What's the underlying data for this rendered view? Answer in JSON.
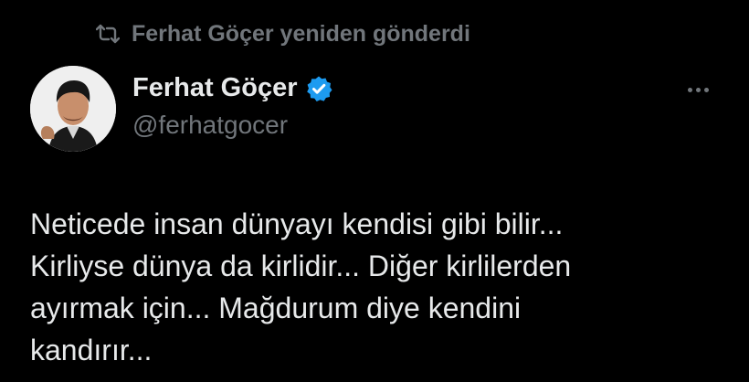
{
  "repost": {
    "icon": "repost-icon",
    "label": "Ferhat Göçer yeniden gönderdi"
  },
  "author": {
    "name": "Ferhat Göçer",
    "handle": "@ferhatgocer",
    "verified": true,
    "verified_color": "#1d9bf0",
    "avatar_icon": "avatar"
  },
  "menu": {
    "icon": "more-icon"
  },
  "tweet": {
    "lines": [
      "Neticede insan dünyayı kendisi gibi bilir...",
      "Kirliyse dünya da kirlidir... Diğer kirlilerden",
      "ayırmak için... Mağdurum diye kendini",
      "kandırır..."
    ]
  },
  "colors": {
    "background": "#000000",
    "primary_text": "#e7e9ea",
    "secondary_text": "#71767b"
  }
}
